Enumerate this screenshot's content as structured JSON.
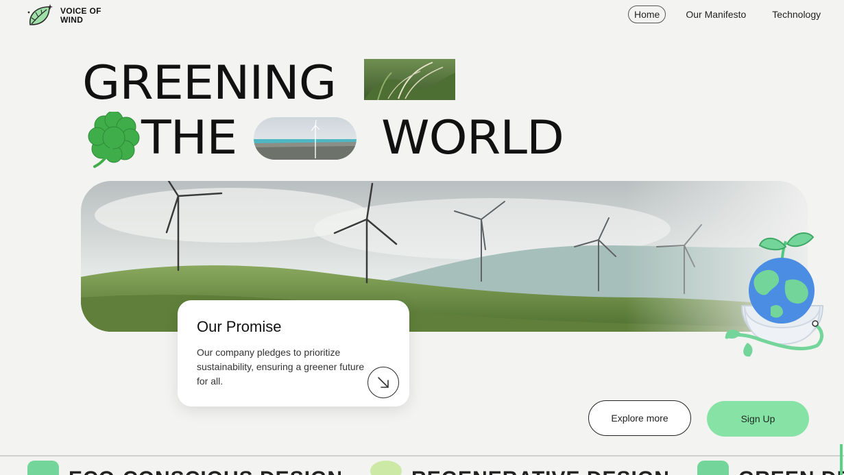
{
  "brand": {
    "name_line1": "VOICE OF",
    "name_line2": "WIND"
  },
  "nav": {
    "items": [
      {
        "label": "Home",
        "active": true
      },
      {
        "label": "Our Manifesto",
        "active": false
      },
      {
        "label": "Technology",
        "active": false
      }
    ]
  },
  "headline": {
    "word1": "GREENING",
    "word2": "THE",
    "word3": "WORLD"
  },
  "promise": {
    "title": "Our Promise",
    "text": "Our company pledges to prioritize sustainability, ensuring a greener future for all."
  },
  "cta": {
    "explore_label": "Explore more",
    "signup_label": "Sign Up"
  },
  "marquee": [
    {
      "label": "ECO-CONSCIOUS DESIGN",
      "icon": "leaf-icon"
    },
    {
      "label": "REGENERATIVE DESIGN",
      "icon": "sprout-icon"
    },
    {
      "label": "GREEN DESI",
      "icon": "leaf-icon"
    }
  ],
  "colors": {
    "accent": "#86e3a5",
    "background": "#f3f3f2",
    "text": "#111111"
  }
}
